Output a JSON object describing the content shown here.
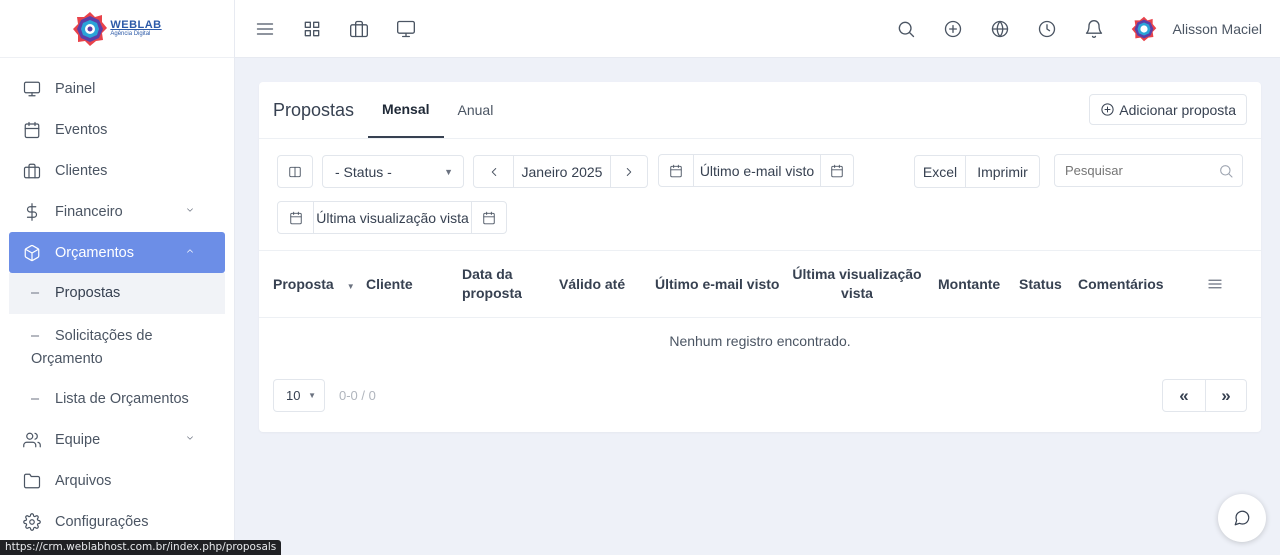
{
  "brand": {
    "logo_line1": "WEBLAB",
    "logo_line2": "Agência Digital"
  },
  "sidebar": {
    "items": [
      {
        "label": "Painel",
        "icon": "monitor-icon"
      },
      {
        "label": "Eventos",
        "icon": "calendar-icon"
      },
      {
        "label": "Clientes",
        "icon": "briefcase-icon"
      },
      {
        "label": "Financeiro",
        "icon": "dollar-icon"
      },
      {
        "label": "Orçamentos",
        "icon": "box-icon"
      }
    ],
    "sub": [
      "Propostas",
      "Solicitações de Orçamento",
      "Lista de Orçamentos"
    ],
    "items2": [
      {
        "label": "Equipe",
        "icon": "users-icon"
      },
      {
        "label": "Arquivos",
        "icon": "folder-icon"
      },
      {
        "label": "Configurações",
        "icon": "gear-icon"
      }
    ],
    "dash": "–"
  },
  "topbar": {
    "user_name": "Alisson Maciel"
  },
  "page": {
    "title": "Propostas",
    "tabs": [
      "Mensal",
      "Anual"
    ],
    "add_label": "Adicionar proposta"
  },
  "filters": {
    "status": "- Status -",
    "month": "Janeiro 2025",
    "last_email": "Último e-mail visto",
    "excel": "Excel",
    "print": "Imprimir",
    "search_placeholder": "Pesquisar",
    "last_view": "Última visualização vista"
  },
  "table": {
    "columns": [
      "Proposta",
      "Cliente",
      "Data da proposta",
      "Válido até",
      "Último e-mail visto",
      "Última visualização vista",
      "Montante",
      "Status",
      "Comentários"
    ],
    "empty": "Nenhum registro encontrado."
  },
  "pagination": {
    "per_page": "10",
    "range": "0-0 / 0",
    "prev": "«",
    "next": "»"
  },
  "status_url": "https://crm.weblabhost.com.br/index.php/proposals",
  "colors": {
    "accent": "#6c8ee7",
    "background": "#eef1f8"
  }
}
